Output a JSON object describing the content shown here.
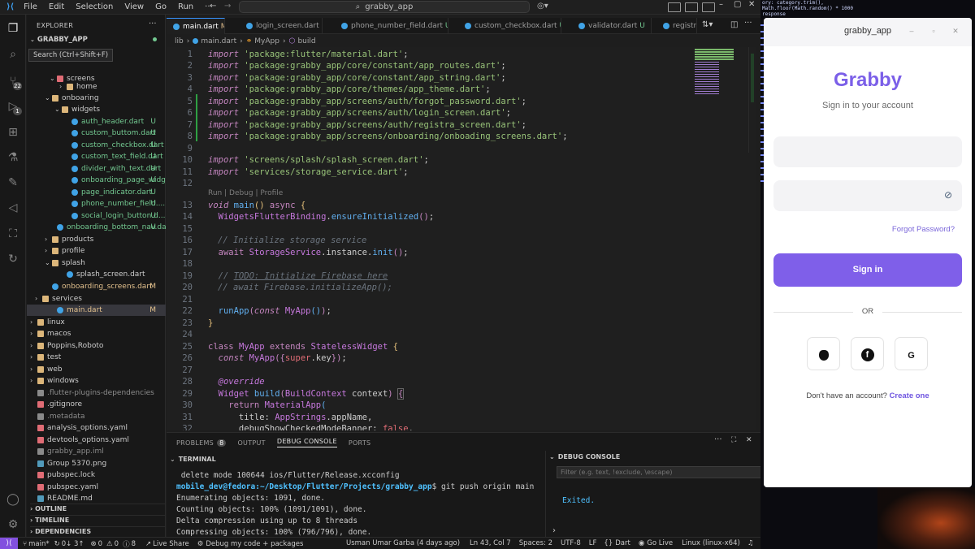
{
  "menu": [
    "File",
    "Edit",
    "Selection",
    "View",
    "Go",
    "Run"
  ],
  "search_box": "grabby_app",
  "explorer": {
    "header": "EXPLORER",
    "project": "GRABBY_APP",
    "tooltip": "Search (Ctrl+Shift+F)",
    "items": [
      {
        "label": "home",
        "status": ""
      },
      {
        "label": "screens",
        "status": ""
      },
      {
        "label": "onboaring",
        "status": ""
      },
      {
        "label": "widgets",
        "status": ""
      },
      {
        "label": "auth_header.dart",
        "status": "U"
      },
      {
        "label": "custom_buttom.dart",
        "status": "U"
      },
      {
        "label": "custom_checkbox.dart",
        "status": "U"
      },
      {
        "label": "custom_text_field.dart",
        "status": "U"
      },
      {
        "label": "divider_with_text.dart",
        "status": "U"
      },
      {
        "label": "onboarding_page_widget....",
        "status": "U"
      },
      {
        "label": "page_indicator.dart",
        "status": "U"
      },
      {
        "label": "phone_number_field....",
        "status": "U"
      },
      {
        "label": "social_login_button.d...",
        "status": "U"
      },
      {
        "label": "onboarding_bottom_nav.dart",
        "status": "U"
      },
      {
        "label": "products",
        "status": ""
      },
      {
        "label": "profile",
        "status": ""
      },
      {
        "label": "splash",
        "status": ""
      },
      {
        "label": "splash_screen.dart",
        "status": ""
      },
      {
        "label": "onboarding_screens.dart",
        "status": "M"
      },
      {
        "label": "services",
        "status": ""
      },
      {
        "label": "main.dart",
        "status": "M"
      },
      {
        "label": "linux",
        "status": ""
      },
      {
        "label": "macos",
        "status": ""
      },
      {
        "label": "Poppins,Roboto",
        "status": ""
      },
      {
        "label": "test",
        "status": ""
      },
      {
        "label": "web",
        "status": ""
      },
      {
        "label": "windows",
        "status": ""
      },
      {
        "label": ".flutter-plugins-dependencies",
        "status": ""
      },
      {
        "label": ".gitignore",
        "status": ""
      },
      {
        "label": ".metadata",
        "status": ""
      },
      {
        "label": "analysis_options.yaml",
        "status": ""
      },
      {
        "label": "devtools_options.yaml",
        "status": ""
      },
      {
        "label": "grabby_app.iml",
        "status": ""
      },
      {
        "label": "Group 5370.png",
        "status": ""
      },
      {
        "label": "pubspec.lock",
        "status": ""
      },
      {
        "label": "pubspec.yaml",
        "status": ""
      },
      {
        "label": "README.md",
        "status": ""
      }
    ],
    "outline": "OUTLINE",
    "timeline": "TIMELINE",
    "dependencies": "DEPENDENCIES"
  },
  "tabs": [
    {
      "label": "main.dart",
      "status": "M"
    },
    {
      "label": "login_screen.dart",
      "status": "U"
    },
    {
      "label": "phone_number_field.dart",
      "status": "U"
    },
    {
      "label": "custom_checkbox.dart",
      "status": "U"
    },
    {
      "label": "validator.dart",
      "status": "U"
    },
    {
      "label": "registr",
      "status": ""
    }
  ],
  "breadcrumb": {
    "a": "lib",
    "b": "main.dart",
    "c": "MyApp",
    "d": "build"
  },
  "editor": {
    "line_numbers": [
      "1",
      "2",
      "3",
      "4",
      "5",
      "6",
      "7",
      "8",
      "9",
      "10",
      "11",
      "12",
      "13",
      "14",
      "15",
      "16",
      "17",
      "18",
      "19",
      "20",
      "21",
      "22",
      "23",
      "24",
      "25",
      "26",
      "27",
      "28",
      "29",
      "30",
      "31",
      "32"
    ],
    "imports": [
      "'package:flutter/material.dart'",
      "'package:grabby_app/core/constant/app_routes.dart'",
      "'package:grabby_app/core/constant/app_string.dart'",
      "'package:grabby_app/core/themes/app_theme.dart'",
      "'package:grabby_app/screens/auth/forgot_password.dart'",
      "'package:grabby_app/screens/auth/login_screen.dart'",
      "'package:grabby_app/screens/auth/registra_screen.dart'",
      "'package:grabby_app/screens/onboarding/onboading_screens.dart'",
      "'screens/splash/splash_screen.dart'",
      "'services/storage_service.dart'"
    ],
    "codelens": "Run | Debug | Profile",
    "comment_storage": "// Initialize storage service",
    "comment_todo": "TODO: Initialize Firebase here",
    "comment_firebase": "// await Firebase.initializeApp();"
  },
  "panel": {
    "problems": "PROBLEMS",
    "problems_count": "8",
    "output": "OUTPUT",
    "debug_console": "DEBUG CONSOLE",
    "ports": "PORTS",
    "terminal_title": "TERMINAL",
    "terminal_lines": [
      " delete mode 100644 ios/Flutter/Release.xcconfig",
      "Enumerating objects: 1091, done.",
      "Counting objects: 100% (1091/1091), done.",
      "Delta compression using up to 8 threads",
      "Compressing objects: 100% (796/796), done."
    ],
    "prompt_user": "mobile_dev@fedora",
    "prompt_path": ":~/Desktop/Flutter/Projects/grabby_app",
    "prompt_cmd": "$ git push origin main",
    "debug_title": "DEBUG CONSOLE",
    "filter_placeholder": "Filter (e.g. text, !exclude, \\escape)",
    "debug_output": "Exited."
  },
  "status": {
    "branch": "main*",
    "sync": "0↓ 3↑",
    "errors": "0",
    "warnings": "0",
    "infos": "8",
    "live_share": "Live Share",
    "debug": "Debug my code + packages",
    "blame": "Usman Umar Garba (4 days ago)",
    "position": "Ln 43, Col 7",
    "spaces": "Spaces: 2",
    "encoding": "UTF-8",
    "eol": "LF",
    "language": "Dart",
    "go_live": "Go Live",
    "device": "Linux (linux-x64)"
  },
  "peek_lines": [
    "ory: category.trim(),",
    "Math.floor(Math.random() * 1000",
    "response"
  ],
  "app": {
    "window_title": "grabby_app",
    "logo": "Grabby",
    "subtitle": "Sign in to your account",
    "forgot": "Forgot Password?",
    "signin": "Sign in",
    "or": "OR",
    "social": {
      "apple": "",
      "facebook": "f",
      "google": "G"
    },
    "no_account": "Don't have an account?",
    "create": "Create one"
  }
}
